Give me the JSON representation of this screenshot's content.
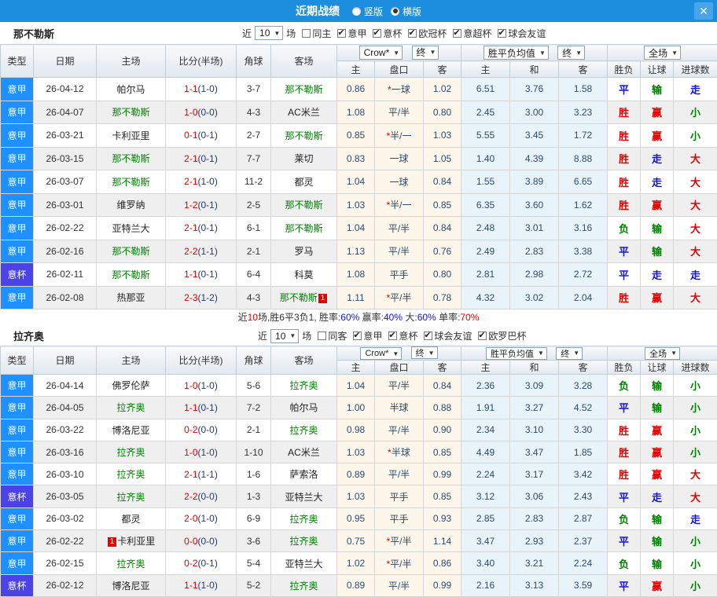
{
  "titlebar": {
    "title": "近期战绩",
    "radios": [
      {
        "label": "竖版",
        "selected": false
      },
      {
        "label": "横版",
        "selected": true
      }
    ],
    "close_label": "✕"
  },
  "table": {
    "near": "近",
    "match_count": "10",
    "games_suffix": "场",
    "headers": {
      "type": "类型",
      "date": "日期",
      "home": "主场",
      "score": "比分(半场)",
      "corner": "角球",
      "away": "客场",
      "h": "主",
      "handicap": "盘口",
      "a": "客",
      "avg_h": "主",
      "avg_d": "和",
      "avg_a": "客",
      "result": "胜负",
      "handicap_result": "让球",
      "goals": "进球数"
    },
    "selectors": {
      "company": "Crow*",
      "final1": "终",
      "avg": "胜平负均值",
      "final2": "终",
      "scope": "全场"
    }
  },
  "type_colors": {
    "意甲": "#1e90ff",
    "意杯": "#4b42e8"
  },
  "result_colors": {
    "胜": "#e60000",
    "平": "#1212dd",
    "负": "#008000",
    "赢": "#e60000",
    "输": "#008000",
    "走": "#1212dd",
    "大": "#e60000",
    "小": "#008000"
  },
  "sections": [
    {
      "team": "那不勒斯",
      "filters": [
        {
          "label": "同主",
          "checked": false
        },
        {
          "label": "意甲",
          "checked": true
        },
        {
          "label": "意杯",
          "checked": true
        },
        {
          "label": "欧冠杯",
          "checked": true
        },
        {
          "label": "意超杯",
          "checked": true
        },
        {
          "label": "球会友谊",
          "checked": true
        }
      ],
      "rows": [
        {
          "type": "意甲",
          "date": "26-04-12",
          "home": "帕尔马",
          "home_focus": false,
          "home_badge": "",
          "score": "1-1",
          "half": "(1-0)",
          "corner": "3-7",
          "away": "那不勒斯",
          "away_focus": true,
          "away_badge": "",
          "o1": "0.86",
          "hcp": "一球",
          "hcp_star": true,
          "o2": "1.02",
          "a1": "6.51",
          "a2": "3.76",
          "a3": "1.58",
          "r1": "平",
          "r2": "输",
          "r3": "走"
        },
        {
          "type": "意甲",
          "date": "26-04-07",
          "home": "那不勒斯",
          "home_focus": true,
          "home_badge": "",
          "score": "1-0",
          "half": "(0-0)",
          "corner": "4-3",
          "away": "AC米兰",
          "away_focus": false,
          "away_badge": "",
          "o1": "1.08",
          "hcp": "平/半",
          "hcp_star": false,
          "o2": "0.80",
          "a1": "2.45",
          "a2": "3.00",
          "a3": "3.23",
          "r1": "胜",
          "r2": "赢",
          "r3": "小"
        },
        {
          "type": "意甲",
          "date": "26-03-21",
          "home": "卡利亚里",
          "home_focus": false,
          "home_badge": "",
          "score": "0-1",
          "half": "(0-1)",
          "corner": "2-7",
          "away": "那不勒斯",
          "away_focus": true,
          "away_badge": "",
          "o1": "0.85",
          "hcp": "半/一",
          "hcp_star": true,
          "o2": "1.03",
          "a1": "5.55",
          "a2": "3.45",
          "a3": "1.72",
          "r1": "胜",
          "r2": "赢",
          "r3": "小"
        },
        {
          "type": "意甲",
          "date": "26-03-15",
          "home": "那不勒斯",
          "home_focus": true,
          "home_badge": "",
          "score": "2-1",
          "half": "(0-1)",
          "corner": "7-7",
          "away": "莱切",
          "away_focus": false,
          "away_badge": "",
          "o1": "0.83",
          "hcp": "一球",
          "hcp_star": false,
          "o2": "1.05",
          "a1": "1.40",
          "a2": "4.39",
          "a3": "8.88",
          "r1": "胜",
          "r2": "走",
          "r3": "大"
        },
        {
          "type": "意甲",
          "date": "26-03-07",
          "home": "那不勒斯",
          "home_focus": true,
          "home_badge": "",
          "score": "2-1",
          "half": "(1-0)",
          "corner": "11-2",
          "away": "都灵",
          "away_focus": false,
          "away_badge": "",
          "o1": "1.04",
          "hcp": "一球",
          "hcp_star": false,
          "o2": "0.84",
          "a1": "1.55",
          "a2": "3.89",
          "a3": "6.65",
          "r1": "胜",
          "r2": "走",
          "r3": "大"
        },
        {
          "type": "意甲",
          "date": "26-03-01",
          "home": "维罗纳",
          "home_focus": false,
          "home_badge": "",
          "score": "1-2",
          "half": "(0-1)",
          "corner": "2-5",
          "away": "那不勒斯",
          "away_focus": true,
          "away_badge": "",
          "o1": "1.03",
          "hcp": "半/一",
          "hcp_star": true,
          "o2": "0.85",
          "a1": "6.35",
          "a2": "3.60",
          "a3": "1.62",
          "r1": "胜",
          "r2": "赢",
          "r3": "大"
        },
        {
          "type": "意甲",
          "date": "26-02-22",
          "home": "亚特兰大",
          "home_focus": false,
          "home_badge": "",
          "score": "2-1",
          "half": "(0-1)",
          "corner": "6-1",
          "away": "那不勒斯",
          "away_focus": true,
          "away_badge": "",
          "o1": "1.04",
          "hcp": "平/半",
          "hcp_star": false,
          "o2": "0.84",
          "a1": "2.48",
          "a2": "3.01",
          "a3": "3.16",
          "r1": "负",
          "r2": "输",
          "r3": "大"
        },
        {
          "type": "意甲",
          "date": "26-02-16",
          "home": "那不勒斯",
          "home_focus": true,
          "home_badge": "",
          "score": "2-2",
          "half": "(1-1)",
          "corner": "2-1",
          "away": "罗马",
          "away_focus": false,
          "away_badge": "",
          "o1": "1.13",
          "hcp": "平/半",
          "hcp_star": false,
          "o2": "0.76",
          "a1": "2.49",
          "a2": "2.83",
          "a3": "3.38",
          "r1": "平",
          "r2": "输",
          "r3": "大"
        },
        {
          "type": "意杯",
          "date": "26-02-11",
          "home": "那不勒斯",
          "home_focus": true,
          "home_badge": "",
          "score": "1-1",
          "half": "(0-1)",
          "corner": "6-4",
          "away": "科莫",
          "away_focus": false,
          "away_badge": "",
          "o1": "1.08",
          "hcp": "平手",
          "hcp_star": false,
          "o2": "0.80",
          "a1": "2.81",
          "a2": "2.98",
          "a3": "2.72",
          "r1": "平",
          "r2": "走",
          "r3": "走"
        },
        {
          "type": "意甲",
          "date": "26-02-08",
          "home": "热那亚",
          "home_focus": false,
          "home_badge": "",
          "score": "2-3",
          "half": "(1-2)",
          "corner": "4-3",
          "away": "那不勒斯",
          "away_focus": true,
          "away_badge": "1",
          "o1": "1.11",
          "hcp": "平/半",
          "hcp_star": true,
          "o2": "0.78",
          "a1": "4.32",
          "a2": "3.02",
          "a3": "2.04",
          "r1": "胜",
          "r2": "赢",
          "r3": "大"
        }
      ],
      "summary_parts": [
        {
          "t": "近",
          "c": "#333333"
        },
        {
          "t": "10",
          "c": "#e60000"
        },
        {
          "t": "场,胜6平3负1, 胜率:",
          "c": "#333333"
        },
        {
          "t": "60%",
          "c": "#1212dd"
        },
        {
          "t": " 赢率:",
          "c": "#333333"
        },
        {
          "t": "40%",
          "c": "#1212dd"
        },
        {
          "t": " 大:",
          "c": "#333333"
        },
        {
          "t": "60%",
          "c": "#1212dd"
        },
        {
          "t": " 单率:",
          "c": "#333333"
        },
        {
          "t": "70%",
          "c": "#e60000"
        }
      ]
    },
    {
      "team": "拉齐奥",
      "filters": [
        {
          "label": "同客",
          "checked": false
        },
        {
          "label": "意甲",
          "checked": true
        },
        {
          "label": "意杯",
          "checked": true
        },
        {
          "label": "球会友谊",
          "checked": true
        },
        {
          "label": "欧罗巴杯",
          "checked": true
        }
      ],
      "rows": [
        {
          "type": "意甲",
          "date": "26-04-14",
          "home": "佛罗伦萨",
          "home_focus": false,
          "home_badge": "",
          "score": "1-0",
          "half": "(1-0)",
          "corner": "5-6",
          "away": "拉齐奥",
          "away_focus": true,
          "away_badge": "",
          "o1": "1.04",
          "hcp": "平/半",
          "hcp_star": false,
          "o2": "0.84",
          "a1": "2.36",
          "a2": "3.09",
          "a3": "3.28",
          "r1": "负",
          "r2": "输",
          "r3": "小"
        },
        {
          "type": "意甲",
          "date": "26-04-05",
          "home": "拉齐奥",
          "home_focus": true,
          "home_badge": "",
          "score": "1-1",
          "half": "(0-1)",
          "corner": "7-2",
          "away": "帕尔马",
          "away_focus": false,
          "away_badge": "",
          "o1": "1.00",
          "hcp": "半球",
          "hcp_star": false,
          "o2": "0.88",
          "a1": "1.91",
          "a2": "3.27",
          "a3": "4.52",
          "r1": "平",
          "r2": "输",
          "r3": "小"
        },
        {
          "type": "意甲",
          "date": "26-03-22",
          "home": "博洛尼亚",
          "home_focus": false,
          "home_badge": "",
          "score": "0-2",
          "half": "(0-0)",
          "corner": "2-1",
          "away": "拉齐奥",
          "away_focus": true,
          "away_badge": "",
          "o1": "0.98",
          "hcp": "平/半",
          "hcp_star": false,
          "o2": "0.90",
          "a1": "2.34",
          "a2": "3.10",
          "a3": "3.30",
          "r1": "胜",
          "r2": "赢",
          "r3": "小"
        },
        {
          "type": "意甲",
          "date": "26-03-16",
          "home": "拉齐奥",
          "home_focus": true,
          "home_badge": "",
          "score": "1-0",
          "half": "(1-0)",
          "corner": "1-10",
          "away": "AC米兰",
          "away_focus": false,
          "away_badge": "",
          "o1": "1.03",
          "hcp": "半球",
          "hcp_star": true,
          "o2": "0.85",
          "a1": "4.49",
          "a2": "3.47",
          "a3": "1.85",
          "r1": "胜",
          "r2": "赢",
          "r3": "小"
        },
        {
          "type": "意甲",
          "date": "26-03-10",
          "home": "拉齐奥",
          "home_focus": true,
          "home_badge": "",
          "score": "2-1",
          "half": "(1-1)",
          "corner": "1-6",
          "away": "萨索洛",
          "away_focus": false,
          "away_badge": "",
          "o1": "0.89",
          "hcp": "平/半",
          "hcp_star": false,
          "o2": "0.99",
          "a1": "2.24",
          "a2": "3.17",
          "a3": "3.42",
          "r1": "胜",
          "r2": "赢",
          "r3": "大"
        },
        {
          "type": "意杯",
          "date": "26-03-05",
          "home": "拉齐奥",
          "home_focus": true,
          "home_badge": "",
          "score": "2-2",
          "half": "(0-0)",
          "corner": "1-3",
          "away": "亚特兰大",
          "away_focus": false,
          "away_badge": "",
          "o1": "1.03",
          "hcp": "平手",
          "hcp_star": false,
          "o2": "0.85",
          "a1": "3.12",
          "a2": "3.06",
          "a3": "2.43",
          "r1": "平",
          "r2": "走",
          "r3": "大"
        },
        {
          "type": "意甲",
          "date": "26-03-02",
          "home": "都灵",
          "home_focus": false,
          "home_badge": "",
          "score": "2-0",
          "half": "(1-0)",
          "corner": "6-9",
          "away": "拉齐奥",
          "away_focus": true,
          "away_badge": "",
          "o1": "0.95",
          "hcp": "平手",
          "hcp_star": false,
          "o2": "0.93",
          "a1": "2.85",
          "a2": "2.83",
          "a3": "2.87",
          "r1": "负",
          "r2": "输",
          "r3": "走"
        },
        {
          "type": "意甲",
          "date": "26-02-22",
          "home": "卡利亚里",
          "home_focus": false,
          "home_badge": "1",
          "score": "0-0",
          "half": "(0-0)",
          "corner": "3-6",
          "away": "拉齐奥",
          "away_focus": true,
          "away_badge": "",
          "o1": "0.75",
          "hcp": "平/半",
          "hcp_star": true,
          "o2": "1.14",
          "a1": "3.47",
          "a2": "2.93",
          "a3": "2.37",
          "r1": "平",
          "r2": "输",
          "r3": "小"
        },
        {
          "type": "意甲",
          "date": "26-02-15",
          "home": "拉齐奥",
          "home_focus": true,
          "home_badge": "",
          "score": "0-2",
          "half": "(0-1)",
          "corner": "5-4",
          "away": "亚特兰大",
          "away_focus": false,
          "away_badge": "",
          "o1": "1.02",
          "hcp": "平/半",
          "hcp_star": true,
          "o2": "0.86",
          "a1": "3.40",
          "a2": "3.21",
          "a3": "2.24",
          "r1": "负",
          "r2": "输",
          "r3": "小"
        },
        {
          "type": "意杯",
          "date": "26-02-12",
          "home": "博洛尼亚",
          "home_focus": false,
          "home_badge": "",
          "score": "1-1",
          "half": "(1-0)",
          "corner": "5-2",
          "away": "拉齐奥",
          "away_focus": true,
          "away_badge": "",
          "o1": "0.89",
          "hcp": "平/半",
          "hcp_star": false,
          "o2": "0.99",
          "a1": "2.16",
          "a2": "3.13",
          "a3": "3.59",
          "r1": "平",
          "r2": "赢",
          "r3": "小"
        }
      ]
    }
  ]
}
